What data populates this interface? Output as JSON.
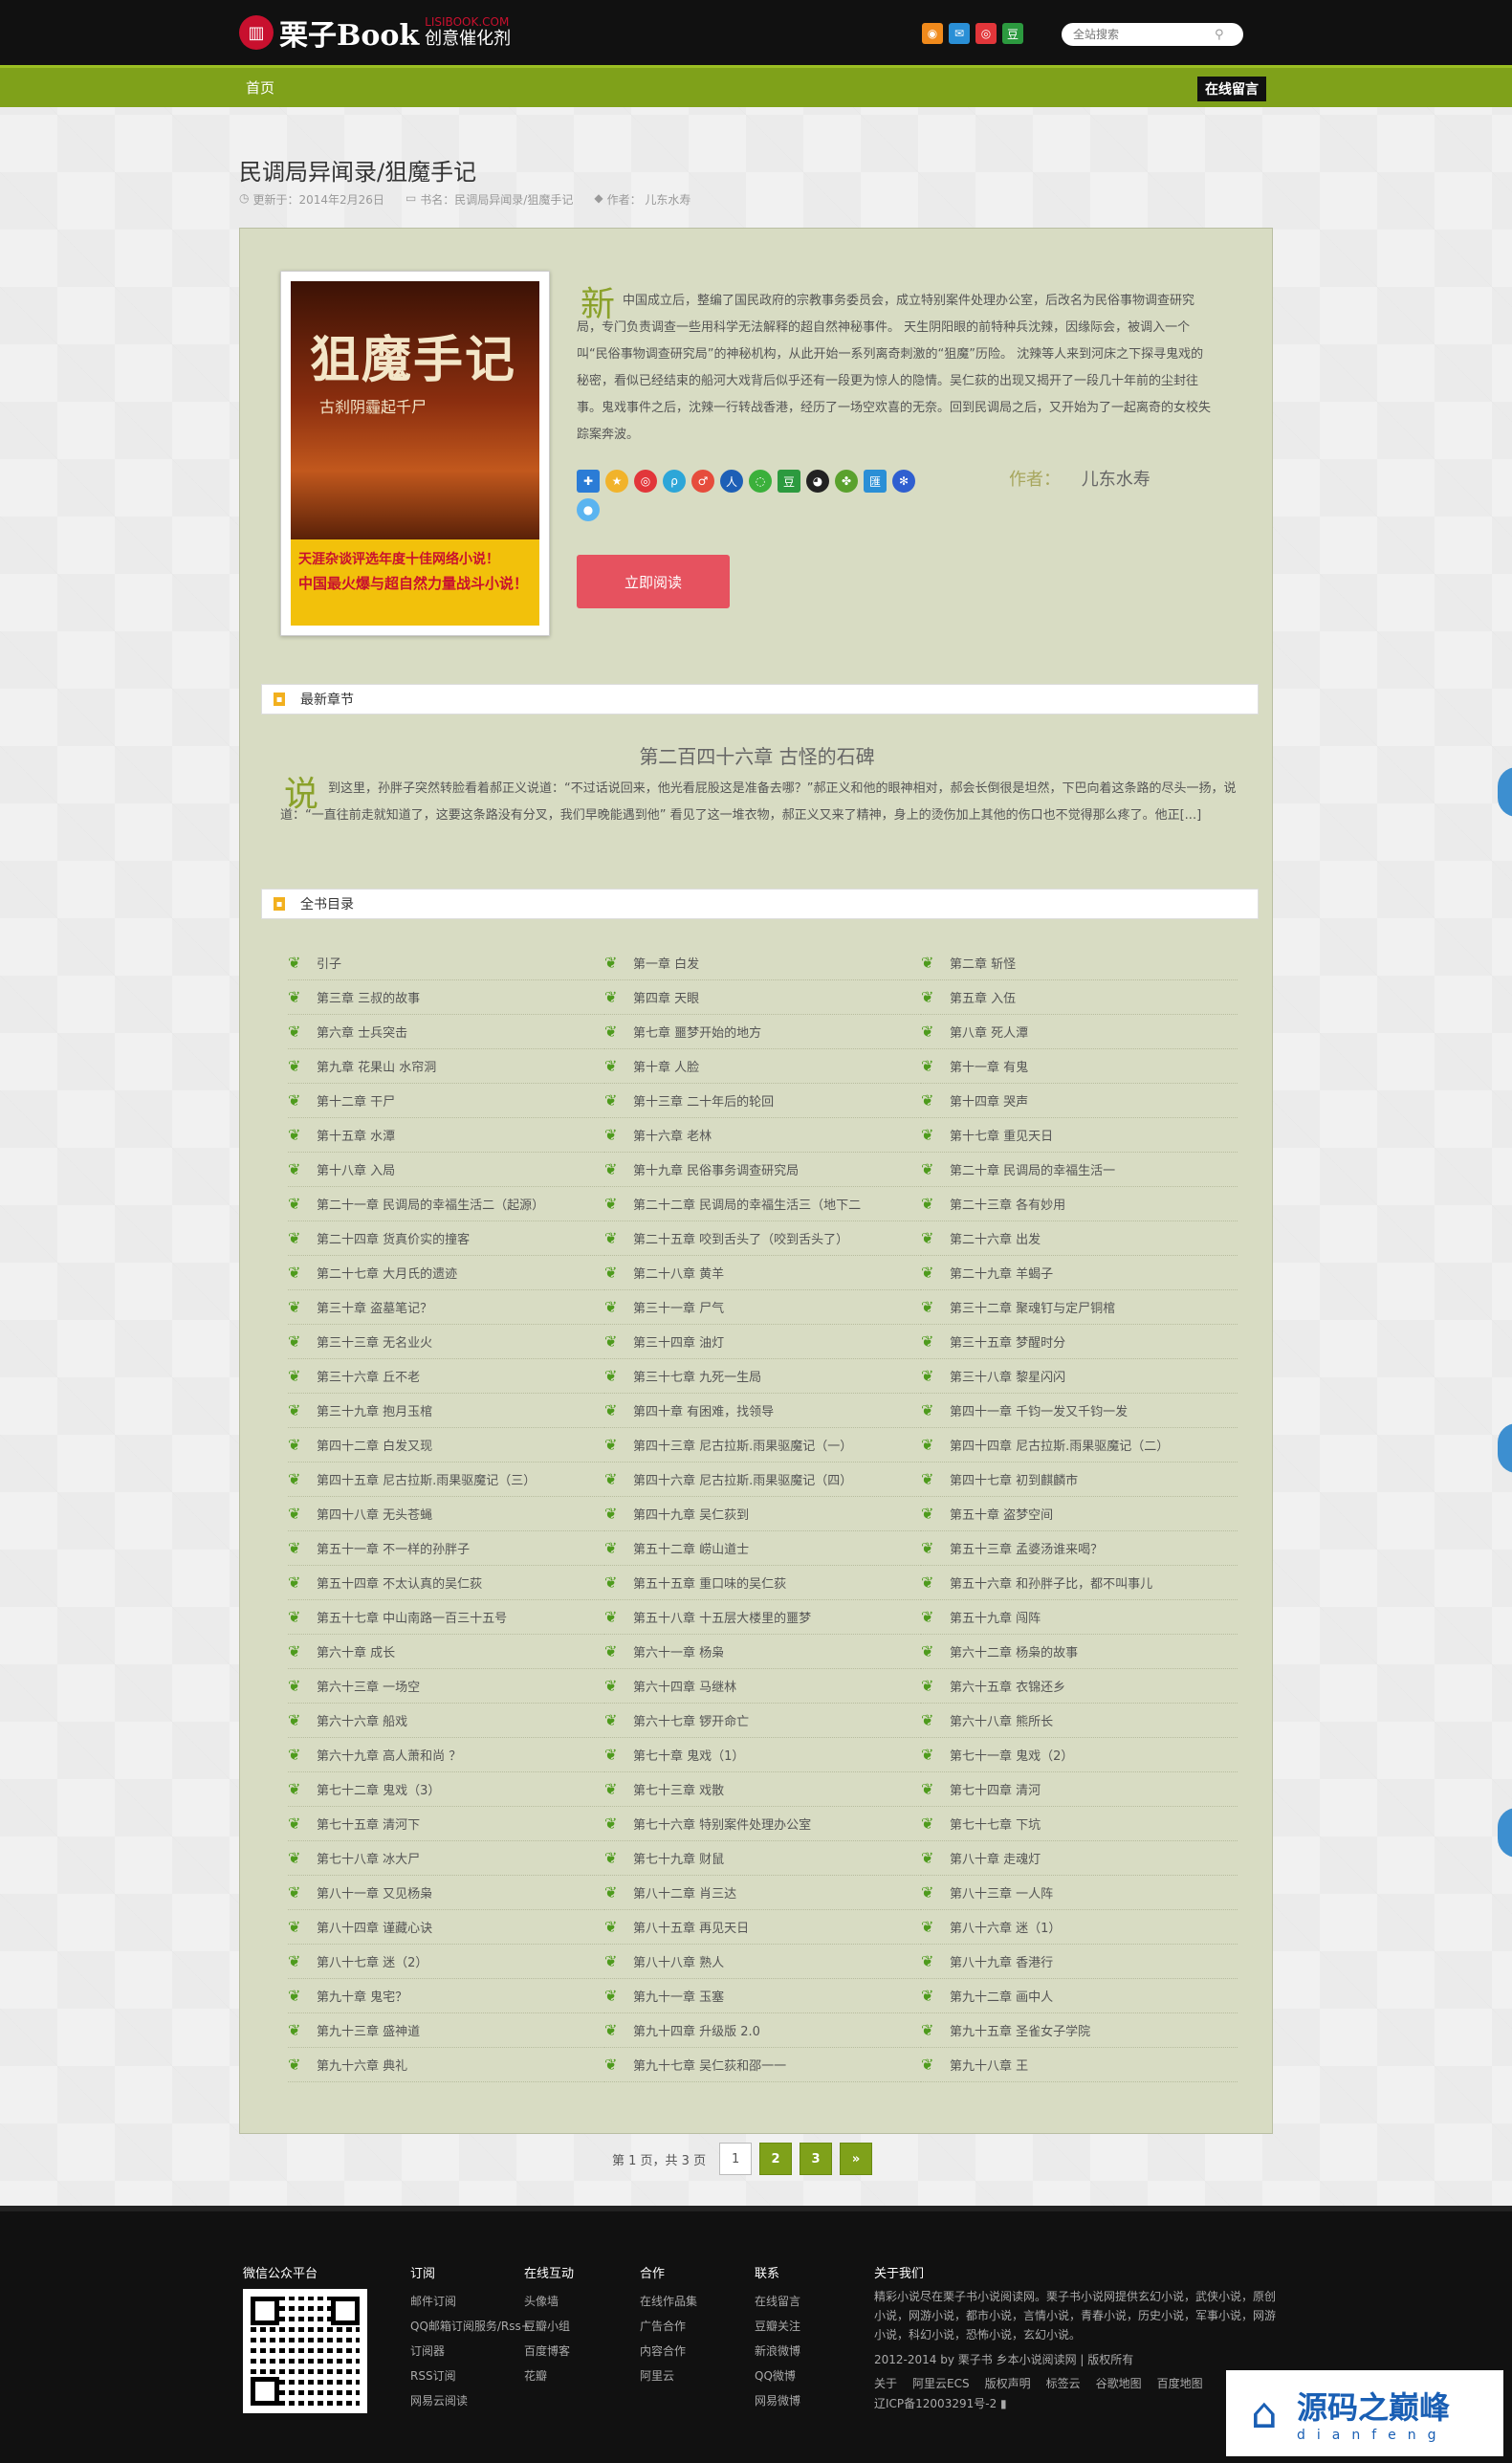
{
  "header": {
    "logo_main": "栗子Book",
    "logo_sub": "LISIBOOK.COM",
    "logo_slogan": "创意催化剂",
    "social_icons": [
      "rss-icon",
      "mail-icon",
      "weibo-icon",
      "douban-icon"
    ],
    "search_placeholder": "全站搜索"
  },
  "nav": {
    "home": "首页",
    "message": "在线留言"
  },
  "book": {
    "title": "民调局异闻录/狙魔手记",
    "updated": "更新于：2014年2月26日",
    "book_name": "书名：民调局异闻录/狙魔手记",
    "author_meta": "作者：  儿东水寿",
    "cover_title": "狙魔手记",
    "cover_sub": "古刹阴霾起千尸",
    "cover_band": "天涯杂谈评选年度十佳网络小说！",
    "cover_band2": "中国最火爆与超自然力量战斗小说！",
    "intro_drop": "新",
    "intro": "中国成立后，整编了国民政府的宗教事务委员会，成立特别案件处理办公室，后改名为民俗事物调查研究局，专门负责调查一些用科学无法解释的超自然神秘事件。 天生阴阳眼的前特种兵沈辣，因缘际会，被调入一个叫“民俗事物调查研究局”的神秘机构，从此开始一系列离奇刺激的“狙魔”历险。 沈辣等人来到河床之下探寻鬼戏的秘密，看似已经结束的船河大戏背后似乎还有一段更为惊人的隐情。吴仁荻的出现又揭开了一段几十年前的尘封往事。鬼戏事件之后，沈辣一行转战香港，经历了一场空欢喜的无奈。回到民调局之后，又开始为了一起离奇的女校失踪案奔波。",
    "author_label": "作者：",
    "author": "儿东水寿",
    "read_button": "立即阅读"
  },
  "share_icons": [
    "qzone-icon",
    "star-icon",
    "weibo-icon",
    "tencent-weibo-icon",
    "renren-icon",
    "kaixin-icon",
    "wechat-icon",
    "douban-icon",
    "qq-icon",
    "clover-icon",
    "pengyou-icon",
    "baidu-icon",
    "qq-bubble-icon"
  ],
  "sections": {
    "latest": "最新章节",
    "toc": "全书目录"
  },
  "latest": {
    "title": "第二百四十六章  古怪的石碑",
    "drop": "说",
    "text": "到这里，孙胖子突然转脸看着郝正义说道：“不过话说回来，他光看屁股这是准备去哪？”郝正义和他的眼神相对，郝会长倒很是坦然，下巴向着这条路的尽头一扬，说道：“一直往前走就知道了，这要这条路没有分叉，我们早晚能遇到他”  看见了这一堆衣物，郝正义又来了精神，身上的烫伤加上其他的伤口也不觉得那么疼了。他正[...]"
  },
  "toc": [
    [
      "引子",
      "第一章 白发",
      "第二章 斩怪"
    ],
    [
      "第三章 三叔的故事",
      "第四章 天眼",
      "第五章 入伍"
    ],
    [
      "第六章 士兵突击",
      "第七章 噩梦开始的地方",
      "第八章 死人潭"
    ],
    [
      "第九章 花果山 水帘洞",
      "第十章 人脸",
      "第十一章 有鬼"
    ],
    [
      "第十二章 干尸",
      "第十三章 二十年后的轮回",
      "第十四章 哭声"
    ],
    [
      "第十五章 水潭",
      "第十六章 老林",
      "第十七章 重见天日"
    ],
    [
      "第十八章 入局",
      "第十九章 民俗事务调查研究局",
      "第二十章 民调局的幸福生活一"
    ],
    [
      "第二十一章 民调局的幸福生活二（起源）",
      "第二十二章 民调局的幸福生活三（地下二",
      "第二十三章 各有妙用"
    ],
    [
      "第二十四章 货真价实的撞客",
      "第二十五章 咬到舌头了（咬到舌头了）",
      "第二十六章 出发"
    ],
    [
      "第二十七章 大月氏的遗迹",
      "第二十八章 黄羊",
      "第二十九章 羊蝎子"
    ],
    [
      "第三十章 盗墓笔记？",
      "第三十一章 尸气",
      "第三十二章 聚魂钉与定尸铜棺"
    ],
    [
      "第三十三章 无名业火",
      "第三十四章 油灯",
      "第三十五章 梦醒时分"
    ],
    [
      "第三十六章 丘不老",
      "第三十七章 九死一生局",
      "第三十八章 黎星闪闪"
    ],
    [
      "第三十九章 抱月玉棺",
      "第四十章 有困难，找领导",
      "第四十一章 千钧一发又千钧一发"
    ],
    [
      "第四十二章 白发又现",
      "第四十三章 尼古拉斯.雨果驱魔记（一）",
      "第四十四章 尼古拉斯.雨果驱魔记（二）"
    ],
    [
      "第四十五章 尼古拉斯.雨果驱魔记（三）",
      "第四十六章 尼古拉斯.雨果驱魔记（四）",
      "第四十七章 初到麒麟市"
    ],
    [
      "第四十八章 无头苍蝇",
      "第四十九章 吴仁荻到",
      "第五十章 盗梦空间"
    ],
    [
      "第五十一章 不一样的孙胖子",
      "第五十二章 崂山道士",
      "第五十三章 孟婆汤谁来喝？"
    ],
    [
      "第五十四章 不太认真的吴仁荻",
      "第五十五章 重口味的吴仁荻",
      "第五十六章 和孙胖子比，都不叫事儿"
    ],
    [
      "第五十七章 中山南路一百三十五号",
      "第五十八章 十五层大楼里的噩梦",
      "第五十九章 闯阵"
    ],
    [
      "第六十章 成长",
      "第六十一章 杨枭",
      "第六十二章 杨枭的故事"
    ],
    [
      "第六十三章 一场空",
      "第六十四章 马继林",
      "第六十五章 衣锦还乡"
    ],
    [
      "第六十六章 船戏",
      "第六十七章 锣开命亡",
      "第六十八章 熊所长"
    ],
    [
      "第六十九章 高人萧和尚 ？",
      "第七十章 鬼戏（1）",
      "第七十一章 鬼戏（2）"
    ],
    [
      "第七十二章 鬼戏（3）",
      "第七十三章 戏散",
      "第七十四章 清河"
    ],
    [
      "第七十五章 清河下",
      "第七十六章 特别案件处理办公室",
      "第七十七章 下坑"
    ],
    [
      "第七十八章 冰大尸",
      "第七十九章 财鼠",
      "第八十章 走魂灯"
    ],
    [
      "第八十一章 又见杨枭",
      "第八十二章 肖三达",
      "第八十三章 一人阵"
    ],
    [
      "第八十四章 谨藏心诀",
      "第八十五章 再见天日",
      "第八十六章 迷（1）"
    ],
    [
      "第八十七章 迷（2）",
      "第八十八章 熟人",
      "第八十九章 香港行"
    ],
    [
      "第九十章 鬼宅？",
      "第九十一章 玉塞",
      "第九十二章 画中人"
    ],
    [
      "第九十三章 盛神道",
      "第九十四章 升级版 2.0",
      "第九十五章 圣雀女子学院"
    ],
    [
      "第九十六章 典礼",
      "第九十七章 吴仁荻和邵一一",
      "第九十八章 王"
    ]
  ],
  "pager": {
    "info": "第 1 页，共 3 页",
    "pages": [
      "1",
      "2",
      "3",
      "»"
    ]
  },
  "footer": {
    "wechat": "微信公众平台",
    "cols": [
      {
        "title": "订阅",
        "items": [
          "邮件订阅",
          "QQ邮箱订阅服务/Rss+",
          "订阅器",
          "RSS订阅",
          "网易云阅读"
        ]
      },
      {
        "title": "在线互动",
        "items": [
          "头像墙",
          "豆瓣小组",
          "百度博客",
          "花瓣"
        ]
      },
      {
        "title": "合作",
        "items": [
          "在线作品集",
          "广告合作",
          "内容合作",
          "阿里云"
        ]
      },
      {
        "title": "联系",
        "items": [
          "在线留言",
          "豆瓣关注",
          "新浪微博",
          "QQ微博",
          "网易微博"
        ]
      }
    ],
    "about_title": "关于我们",
    "about_text": "精彩小说尽在栗子书小说阅读网。栗子书小说网提供玄幻小说，武侠小说，原创小说，网游小说，都市小说，言情小说，青春小说，历史小说，军事小说，网游小说，科幻小说，恐怖小说，玄幻小说。",
    "copyright": "2012-2014 by 栗子书 乡本小说阅读网 | 版权所有",
    "links": [
      "关于",
      "阿里云ECS",
      "版权声明",
      "标签云",
      "谷歌地图",
      "百度地图"
    ],
    "icp": "辽ICP备12003291号-2"
  },
  "watermark": {
    "title": "源码之巅峰",
    "sub": "dianfeng"
  },
  "colors": {
    "nav_green": "#7fa11a",
    "read_button": "#e6525f",
    "card_bg": "#d8dcc3"
  }
}
